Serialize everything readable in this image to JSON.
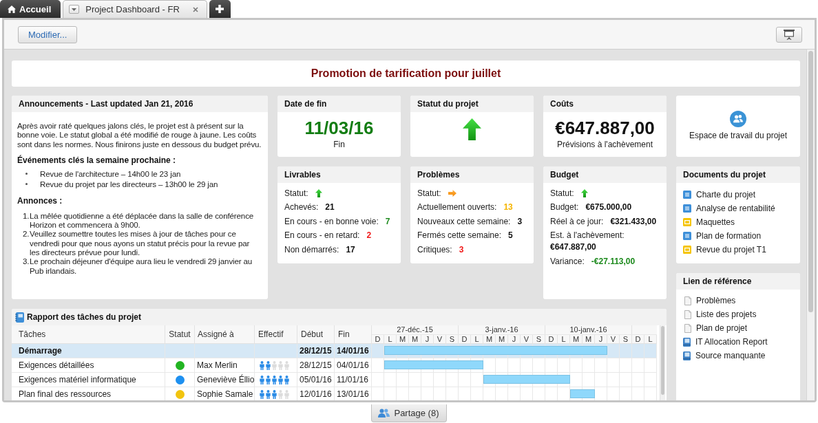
{
  "tabs": [
    {
      "label": "Accueil",
      "kind": "home",
      "selected": false
    },
    {
      "label": "Project Dashboard - FR",
      "kind": "page",
      "selected": true
    }
  ],
  "toolbar": {
    "edit_button": "Modifier..."
  },
  "banner": {
    "title": "Promotion de tarification pour juillet"
  },
  "announcements": {
    "title": "Announcements - Last updated Jan 21, 2016",
    "intro": "Après avoir raté quelques jalons clés, le projet est à présent sur la bonne voie. Le statut global a été modifié de rouge à jaune. Les coûts sont dans les normes. Nous finirons juste en dessous du budget prévu.",
    "events_heading": "Événements clés la semaine prochaine :",
    "events": [
      "Revue de l'architecture – 14h00 le 23 jan",
      "Revue du projet par les directeurs – 13h00 le 29 jan"
    ],
    "notices_heading": "Annonces :",
    "notices": [
      {
        "number": "1.",
        "text": "La mêlée quotidienne a été déplacée dans la salle de conférence Horizon et commencera à 9h00."
      },
      {
        "number": "2.",
        "text": "Veuillez soumettre toutes les mises à jour de tâches pour ce vendredi pour que nous ayons un statut précis pour la revue par les directeurs prévue pour lundi."
      },
      {
        "number": "3.",
        "text": "Le prochain déjeuner d'équipe aura lieu le vendredi 29 janvier au Pub irlandais."
      }
    ]
  },
  "end_date": {
    "title": "Date de fin",
    "value": "11/03/16",
    "caption": "Fin"
  },
  "project_status": {
    "title": "Statut du projet",
    "status": {
      "kind": "up"
    }
  },
  "costs": {
    "title": "Coûts",
    "value": "€647.887,00",
    "caption": "Prévisions à l'achèvement"
  },
  "workspace": {
    "label": "Espace de travail du projet"
  },
  "deliverables": {
    "title": "Livrables",
    "status": {
      "label": "Statut:",
      "kind": "up"
    },
    "rows": [
      {
        "label": "Achevés:",
        "value": "21",
        "color": "#111111"
      },
      {
        "label": "En cours - en bonne voie:",
        "value": "7",
        "color": "#1d8a1d"
      },
      {
        "label": "En cours - en retard:",
        "value": "2",
        "color": "#f01818"
      },
      {
        "label": "Non démarrés:",
        "value": "17",
        "color": "#111111"
      }
    ]
  },
  "issues": {
    "title": "Problèmes",
    "status": {
      "label": "Statut:",
      "kind": "right"
    },
    "rows": [
      {
        "label": "Actuellement ouverts:",
        "value": "13",
        "color": "#f5b400"
      },
      {
        "label": "Nouveaux cette semaine:",
        "value": "3",
        "color": "#111111"
      },
      {
        "label": "Fermés cette semaine:",
        "value": "5",
        "color": "#111111"
      },
      {
        "label": "Critiques:",
        "value": "3",
        "color": "#f01818"
      }
    ]
  },
  "budget": {
    "title": "Budget",
    "status": {
      "label": "Statut:",
      "kind": "up"
    },
    "rows": [
      {
        "label": "Budget:",
        "value": "€675.000,00",
        "color": "#111111"
      },
      {
        "label": "Réel à ce jour:",
        "value": "€321.433,00",
        "color": "#111111"
      },
      {
        "label": "Est. à l'achèvement:",
        "value": "€647.887,00",
        "color": "#111111"
      },
      {
        "label": "Variance:",
        "value": "-€27.113,00",
        "color": "#1d8a1d"
      }
    ]
  },
  "documents": {
    "title": "Documents du projet",
    "items": [
      {
        "label": "Charte du projet",
        "kind": "document"
      },
      {
        "label": "Analyse de rentabilité",
        "kind": "document"
      },
      {
        "label": "Maquettes",
        "kind": "slides"
      },
      {
        "label": "Plan de formation",
        "kind": "document"
      },
      {
        "label": "Revue du projet T1",
        "kind": "slides"
      }
    ]
  },
  "reference_links": {
    "title": "Lien de référence",
    "items": [
      {
        "label": "Problèmes",
        "kind": "page"
      },
      {
        "label": "Liste des projets",
        "kind": "page"
      },
      {
        "label": "Plan de projet",
        "kind": "page"
      },
      {
        "label": "IT Allocation Report",
        "kind": "report"
      },
      {
        "label": "Source manquante",
        "kind": "report"
      }
    ]
  },
  "task_report": {
    "title": "Rapport des tâches du projet",
    "columns": [
      "Tâches",
      "Statut",
      "Assigné à",
      "Effectif",
      "Début",
      "Fin"
    ],
    "weeks": [
      "27-déc.-15",
      "3-janv.-16",
      "10-janv.-16"
    ],
    "days": [
      "D",
      "L",
      "M",
      "M",
      "J",
      "V",
      "S",
      "D",
      "L",
      "M",
      "M",
      "J",
      "V",
      "S",
      "D",
      "L",
      "M",
      "M",
      "J",
      "V",
      "S",
      "D",
      "L"
    ],
    "rows": [
      {
        "kind": "group",
        "task": "Démarrage",
        "start": "28/12/15",
        "end": "14/01/16"
      },
      {
        "kind": "task",
        "task": "Exigences détaillées",
        "color": "#22b422",
        "assignee": "Max Merlin",
        "stars": 2,
        "start": "28/12/15",
        "end": "04/01/16"
      },
      {
        "kind": "task",
        "task": "Exigences matériel informatique",
        "color": "#1e90f0",
        "assignee": "Geneviève Éllio",
        "stars": 5,
        "start": "05/01/16",
        "end": "11/01/16"
      },
      {
        "kind": "task",
        "task": "Plan final des ressources",
        "color": "#f2c40f",
        "assignee": "Sophie Samale",
        "stars": 3,
        "start": "12/01/16",
        "end": "13/01/16"
      }
    ]
  },
  "share_button": "Partage (8)"
}
